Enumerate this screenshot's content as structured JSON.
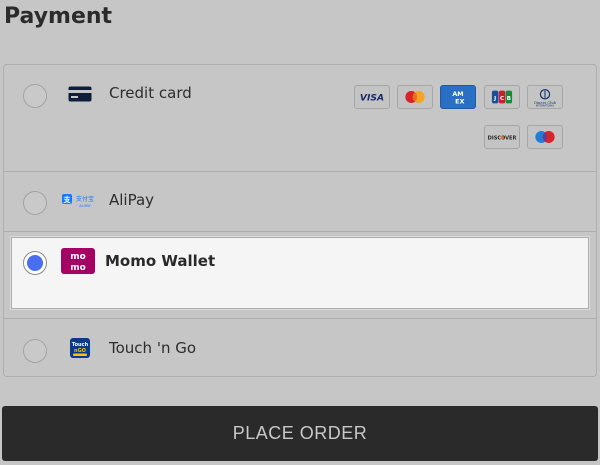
{
  "page": {
    "title": "Payment"
  },
  "methods": [
    {
      "label": "Credit card",
      "icon": "credit-card-icon",
      "selected": false,
      "card_brands": [
        {
          "name": "VISA",
          "icon": "visa-logo"
        },
        {
          "name": "Mastercard",
          "icon": "mastercard-logo"
        },
        {
          "name": "AMEX",
          "icon": "amex-logo"
        },
        {
          "name": "JCB",
          "icon": "jcb-logo"
        },
        {
          "name": "Diners Club",
          "icon": "diners-club-logo"
        },
        {
          "name": "DISCOVER",
          "icon": "discover-logo"
        },
        {
          "name": "Maestro",
          "icon": "maestro-logo"
        }
      ]
    },
    {
      "label": "AliPay",
      "icon": "alipay-icon",
      "icon_text": "支付宝",
      "selected": false
    },
    {
      "label": "Momo Wallet",
      "icon": "momo-icon",
      "icon_text": "mo mo",
      "selected": true
    },
    {
      "label": "Touch 'n Go",
      "icon": "touch-n-go-icon",
      "selected": false
    }
  ],
  "actions": {
    "place_order_label": "PLACE ORDER"
  },
  "colors": {
    "background": "#c6c6c6",
    "selected_background": "#f5f5f5",
    "radio_accent": "#4a6ef0",
    "button_background": "#2a2a2a",
    "button_text": "#c8c8c8",
    "momo_brand": "#a50064",
    "alipay_brand": "#1677ff"
  }
}
